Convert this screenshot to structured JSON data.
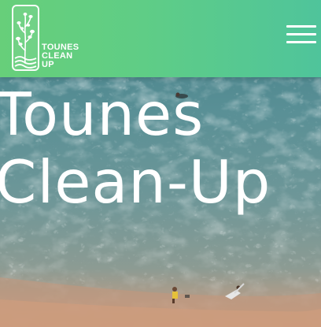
{
  "header": {
    "logo": {
      "line1": "TOUNES",
      "line2": "CLEAN",
      "line3": "UP",
      "icon": "seaweed-plant-icon"
    },
    "menu_icon": "hamburger-menu-icon"
  },
  "hero": {
    "title_line1": "Tounes",
    "title_line2": "Clean-Up"
  },
  "colors": {
    "header_start": "#67cf7a",
    "header_end": "#4fc49b",
    "ocean": "#5f8c8e",
    "sand": "#c79a7a",
    "text": "#ffffff"
  }
}
